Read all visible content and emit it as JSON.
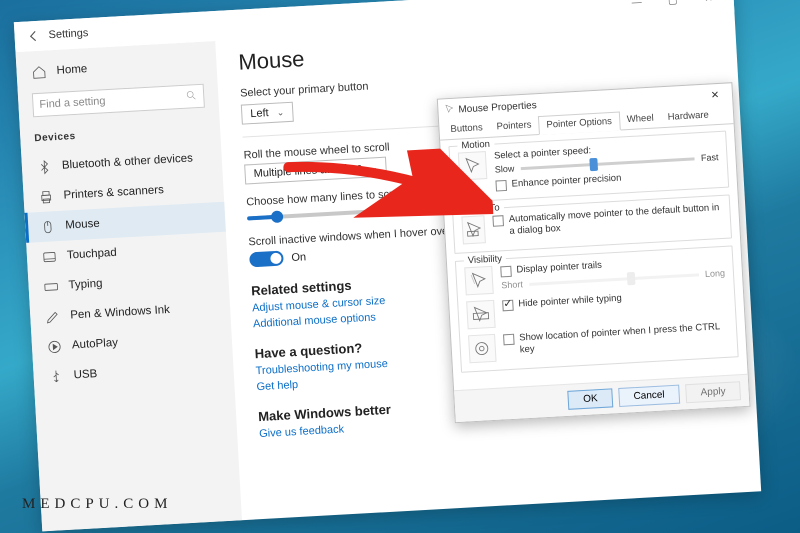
{
  "watermark": "MEDCPU.COM",
  "colors": {
    "accent": "#1a6fc7",
    "link": "#0b6ec7"
  },
  "settings_window": {
    "title": "Settings",
    "back_icon": "arrow-left",
    "winctrls": {
      "min": "—",
      "max": "▢",
      "close": "✕"
    },
    "home_label": "Home",
    "search_placeholder": "Find a setting",
    "group_title": "Devices",
    "sidebar_items": [
      {
        "icon": "bluetooth",
        "label": "Bluetooth & other devices",
        "active": false
      },
      {
        "icon": "printer",
        "label": "Printers & scanners",
        "active": false
      },
      {
        "icon": "mouse",
        "label": "Mouse",
        "active": true
      },
      {
        "icon": "touchpad",
        "label": "Touchpad",
        "active": false
      },
      {
        "icon": "keyboard",
        "label": "Typing",
        "active": false
      },
      {
        "icon": "pen",
        "label": "Pen & Windows Ink",
        "active": false
      },
      {
        "icon": "autoplay",
        "label": "AutoPlay",
        "active": false
      },
      {
        "icon": "usb",
        "label": "USB",
        "active": false
      }
    ],
    "content": {
      "heading": "Mouse",
      "primary_button_label": "Select your primary button",
      "primary_button_value": "Left",
      "roll_label": "Roll the mouse wheel to scroll",
      "roll_value": "Multiple lines at a time",
      "lines_label": "Choose how many lines to scroll each time",
      "lines_value": 3,
      "inactive_label": "Scroll inactive windows when I hover over them",
      "inactive_state_text": "On",
      "inactive_state": true,
      "related_heading": "Related settings",
      "related_links": [
        "Adjust mouse & cursor size",
        "Additional mouse options"
      ],
      "question_heading": "Have a question?",
      "question_links": [
        "Troubleshooting my mouse",
        "Get help"
      ],
      "better_heading": "Make Windows better",
      "better_link": "Give us feedback"
    }
  },
  "mouse_properties": {
    "title": "Mouse Properties",
    "close": "✕",
    "tabs": [
      "Buttons",
      "Pointers",
      "Pointer Options",
      "Wheel",
      "Hardware"
    ],
    "active_tab": 2,
    "motion": {
      "group_label": "Motion",
      "caption": "Select a pointer speed:",
      "slow": "Slow",
      "fast": "Fast",
      "speed_value": 5,
      "speed_max": 11,
      "enhance_label": "Enhance pointer precision",
      "enhance_checked": false
    },
    "snap": {
      "group_label": "Snap To",
      "label": "Automatically move pointer to the default button in a dialog box",
      "checked": false
    },
    "visibility": {
      "group_label": "Visibility",
      "trails_label": "Display pointer trails",
      "trails_checked": false,
      "trails_short": "Short",
      "trails_long": "Long",
      "hide_label": "Hide pointer while typing",
      "hide_checked": true,
      "ctrl_label": "Show location of pointer when I press the CTRL key",
      "ctrl_checked": false
    },
    "buttons": {
      "ok": "OK",
      "cancel": "Cancel",
      "apply": "Apply"
    }
  }
}
